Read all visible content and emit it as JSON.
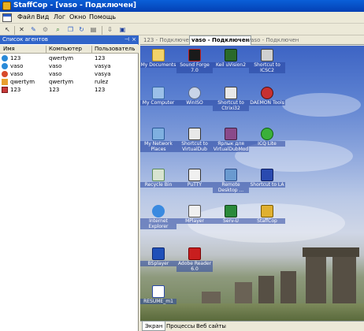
{
  "window": {
    "title": "StaffCop - [vaso - Подключен]"
  },
  "menu": {
    "items": [
      "Файл",
      "Вид",
      "Лог",
      "Окно",
      "Помощь"
    ]
  },
  "toolbar": {
    "icons": [
      "arrow-icon",
      "delete-icon",
      "tool-icon",
      "refresh-icon",
      "save-icon"
    ]
  },
  "agents_panel": {
    "title": "Список агентов",
    "columns": {
      "name": "Имя",
      "computer": "Компьютер",
      "user": "Пользователь"
    },
    "rows": [
      {
        "name": "123",
        "computer": "qwertym",
        "user": "123"
      },
      {
        "name": "vaso",
        "computer": "vaso",
        "user": "vasya"
      },
      {
        "name": "vaso",
        "computer": "vaso",
        "user": "vasya"
      },
      {
        "name": "qwertym",
        "computer": "qwertym",
        "user": "rulez"
      },
      {
        "name": "123",
        "computer": "123",
        "user": "123"
      }
    ]
  },
  "tabs": {
    "t1": "123 - Подключен",
    "t2": "vaso - Подключен",
    "t3": "vaso - Подключен"
  },
  "desktop_icons": {
    "my_documents": "My Documents",
    "sound_forge": "Sound Forge 7.0",
    "keil": "Keil uVision2",
    "icsc2": "Shortcut to ICSC2",
    "my_computer": "My Computer",
    "winiso": "WinISO",
    "citrix": "Shortcut to Ctrixi32",
    "daemon": "DAEMON Tools",
    "network": "My Network Places",
    "virtualdub": "Shortcut to VirtualDub",
    "virtualdubmod": "Ярлык для VirtualDubMod",
    "icq": "ICQ Lite",
    "recycle": "Recycle Bin",
    "putty": "PuTTY",
    "remote": "Remote Desktop ...",
    "la": "Shortcut to LA",
    "ie": "Internet Explorer",
    "mplayer": "MPlayer",
    "servu": "Serv-U",
    "staffcop": "StaffCop",
    "bsplayer": "BSplayer",
    "adobe": "Adobe Reader 6.0",
    "resume": "RESUME_m1"
  },
  "bottom_tabs": {
    "screen": "Экран",
    "processes": "Процессы",
    "websites": "Веб сайты"
  }
}
